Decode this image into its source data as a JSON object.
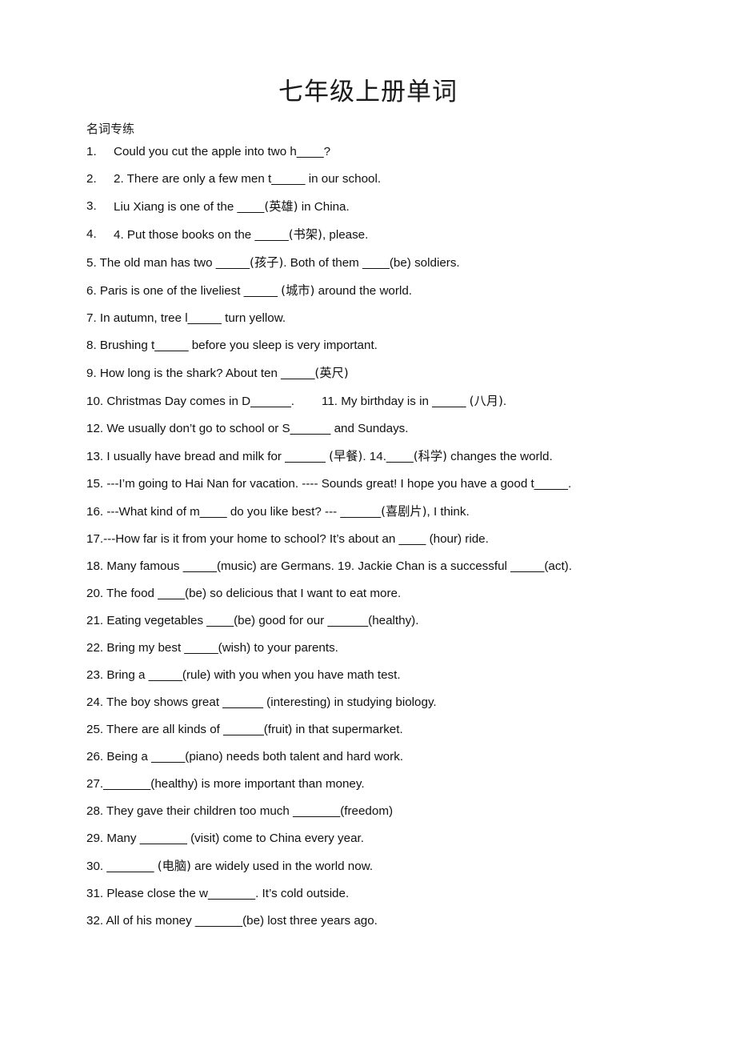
{
  "document": {
    "title": "七年级上册单词",
    "section_label": "名词专练",
    "questions": [
      {
        "n": "1.",
        "style": "numbered",
        "parts": [
          {
            "t": "text",
            "v": "Could you cut the apple into two h"
          },
          {
            "t": "blank",
            "v": "____"
          },
          {
            "t": "text",
            "v": "?"
          }
        ]
      },
      {
        "n": "2.",
        "style": "numbered",
        "parts": [
          {
            "t": "text",
            "v": "2. There are only a few men t"
          },
          {
            "t": "blank",
            "v": "_____"
          },
          {
            "t": "text",
            "v": " in our school."
          }
        ]
      },
      {
        "n": "3.",
        "style": "numbered",
        "parts": [
          {
            "t": "text",
            "v": "Liu Xiang is one of the "
          },
          {
            "t": "blank",
            "v": "____"
          },
          {
            "t": "zh",
            "v": "(英雄)"
          },
          {
            "t": "text",
            "v": " in China."
          }
        ]
      },
      {
        "n": "4.",
        "style": "numbered",
        "parts": [
          {
            "t": "text",
            "v": "4. Put those books on the "
          },
          {
            "t": "blank",
            "v": "_____"
          },
          {
            "t": "zh",
            "v": "(书架)"
          },
          {
            "t": "text",
            "v": ", please."
          }
        ]
      },
      {
        "n": "5.",
        "style": "inline",
        "parts": [
          {
            "t": "text",
            "v": "5. The old man has two "
          },
          {
            "t": "blank",
            "v": "_____"
          },
          {
            "t": "zh",
            "v": "(孩子)"
          },
          {
            "t": "text",
            "v": ". Both of them "
          },
          {
            "t": "blank",
            "v": "____"
          },
          {
            "t": "text",
            "v": "(be) soldiers."
          }
        ]
      },
      {
        "n": "6.",
        "style": "inline",
        "parts": [
          {
            "t": "text",
            "v": "6. Paris is one of the liveliest "
          },
          {
            "t": "blank",
            "v": "_____"
          },
          {
            "t": "text",
            "v": " "
          },
          {
            "t": "zh",
            "v": "(城市)"
          },
          {
            "t": "text",
            "v": " around the world."
          }
        ]
      },
      {
        "n": "7.",
        "style": "inline",
        "parts": [
          {
            "t": "text",
            "v": "7. In autumn, tree l"
          },
          {
            "t": "blank",
            "v": "_____"
          },
          {
            "t": "text",
            "v": " turn yellow."
          }
        ]
      },
      {
        "n": "8.",
        "style": "inline",
        "parts": [
          {
            "t": "text",
            "v": "8. Brushing t"
          },
          {
            "t": "blank",
            "v": "_____"
          },
          {
            "t": "text",
            "v": " before you sleep is very important."
          }
        ]
      },
      {
        "n": "9.",
        "style": "inline",
        "parts": [
          {
            "t": "text",
            "v": "9. How long is the shark? About ten "
          },
          {
            "t": "blank",
            "v": "_____"
          },
          {
            "t": "zh",
            "v": "(英尺)"
          }
        ]
      },
      {
        "n": "10.",
        "style": "inline",
        "parts": [
          {
            "t": "text",
            "v": "10. Christmas Day comes in D"
          },
          {
            "t": "blank",
            "v": "______"
          },
          {
            "t": "text",
            "v": "."
          },
          {
            "t": "gap",
            "v": ""
          },
          {
            "t": "text",
            "v": "11. My birthday is in "
          },
          {
            "t": "blank",
            "v": "_____"
          },
          {
            "t": "text",
            "v": " "
          },
          {
            "t": "zh",
            "v": "(八月)"
          },
          {
            "t": "text",
            "v": "."
          }
        ]
      },
      {
        "n": "12.",
        "style": "inline",
        "parts": [
          {
            "t": "text",
            "v": "12. We usually don’t go to school or S"
          },
          {
            "t": "blank",
            "v": "______"
          },
          {
            "t": "text",
            "v": " and Sundays."
          }
        ]
      },
      {
        "n": "13.",
        "style": "inline",
        "parts": [
          {
            "t": "text",
            "v": "13. I usually have bread and milk for "
          },
          {
            "t": "blank",
            "v": "______"
          },
          {
            "t": "text",
            "v": " "
          },
          {
            "t": "zh",
            "v": "(早餐)"
          },
          {
            "t": "text",
            "v": ".  14."
          },
          {
            "t": "blank",
            "v": "____"
          },
          {
            "t": "zh",
            "v": "(科学)"
          },
          {
            "t": "text",
            "v": " changes the world."
          }
        ]
      },
      {
        "n": "15.",
        "style": "inline",
        "parts": [
          {
            "t": "text",
            "v": "15. ---I’m going to Hai Nan for vacation. ---- Sounds great! I hope you have a good t"
          },
          {
            "t": "blank",
            "v": "_____"
          },
          {
            "t": "text",
            "v": "."
          }
        ]
      },
      {
        "n": "16.",
        "style": "inline",
        "parts": [
          {
            "t": "text",
            "v": "16. ---What kind of m"
          },
          {
            "t": "blank",
            "v": "____"
          },
          {
            "t": "text",
            "v": " do you like best? --- "
          },
          {
            "t": "blank",
            "v": "______"
          },
          {
            "t": "zh",
            "v": "(喜剧片)"
          },
          {
            "t": "text",
            "v": ", I think."
          }
        ]
      },
      {
        "n": "17.",
        "style": "inline",
        "parts": [
          {
            "t": "text",
            "v": "17.---How far is it from your home to school? It’s about an "
          },
          {
            "t": "blank",
            "v": "____"
          },
          {
            "t": "text",
            "v": " (hour) ride."
          }
        ]
      },
      {
        "n": "18.",
        "style": "inline",
        "parts": [
          {
            "t": "text",
            "v": "18. Many famous "
          },
          {
            "t": "blank",
            "v": "_____"
          },
          {
            "t": "text",
            "v": "(music) are Germans. 19. Jackie Chan is a successful "
          },
          {
            "t": "blank",
            "v": "_____"
          },
          {
            "t": "text",
            "v": "(act)."
          }
        ]
      },
      {
        "n": "20.",
        "style": "inline",
        "parts": [
          {
            "t": "text",
            "v": "20. The food "
          },
          {
            "t": "blank",
            "v": "____"
          },
          {
            "t": "text",
            "v": "(be) so delicious that I want to eat more."
          }
        ]
      },
      {
        "n": "21.",
        "style": "inline",
        "parts": [
          {
            "t": "text",
            "v": "21. Eating vegetables "
          },
          {
            "t": "blank",
            "v": "____"
          },
          {
            "t": "text",
            "v": "(be) good for our "
          },
          {
            "t": "blank",
            "v": "______"
          },
          {
            "t": "text",
            "v": "(healthy)."
          }
        ]
      },
      {
        "n": "22.",
        "style": "inline",
        "parts": [
          {
            "t": "text",
            "v": "22. Bring my best "
          },
          {
            "t": "blank",
            "v": "_____"
          },
          {
            "t": "text",
            "v": "(wish) to your parents."
          }
        ]
      },
      {
        "n": "23.",
        "style": "inline",
        "parts": [
          {
            "t": "text",
            "v": "23. Bring a "
          },
          {
            "t": "blank",
            "v": "_____"
          },
          {
            "t": "text",
            "v": "(rule) with you when you have math test."
          }
        ]
      },
      {
        "n": "24.",
        "style": "inline",
        "parts": [
          {
            "t": "text",
            "v": "24. The boy shows great "
          },
          {
            "t": "blank",
            "v": "______"
          },
          {
            "t": "text",
            "v": " (interesting) in studying biology."
          }
        ]
      },
      {
        "n": "25.",
        "style": "inline",
        "parts": [
          {
            "t": "text",
            "v": "25. There are all kinds of "
          },
          {
            "t": "blank",
            "v": "______"
          },
          {
            "t": "text",
            "v": "(fruit) in that supermarket."
          }
        ]
      },
      {
        "n": "26.",
        "style": "inline",
        "parts": [
          {
            "t": "text",
            "v": "26. Being a "
          },
          {
            "t": "blank",
            "v": "_____"
          },
          {
            "t": "text",
            "v": "(piano) needs both talent and hard work."
          }
        ]
      },
      {
        "n": "27.",
        "style": "inline",
        "parts": [
          {
            "t": "text",
            "v": "27."
          },
          {
            "t": "blank",
            "v": "_______"
          },
          {
            "t": "text",
            "v": "(healthy) is more important than money."
          }
        ]
      },
      {
        "n": "28.",
        "style": "inline",
        "parts": [
          {
            "t": "text",
            "v": "28. They gave their children too much "
          },
          {
            "t": "blank",
            "v": "_______"
          },
          {
            "t": "text",
            "v": "(freedom)"
          }
        ]
      },
      {
        "n": "29.",
        "style": "inline",
        "parts": [
          {
            "t": "text",
            "v": "29. Many "
          },
          {
            "t": "blank",
            "v": "_______"
          },
          {
            "t": "text",
            "v": " (visit) come to China every year."
          }
        ]
      },
      {
        "n": "30.",
        "style": "inline",
        "parts": [
          {
            "t": "text",
            "v": "30. "
          },
          {
            "t": "blank",
            "v": "_______"
          },
          {
            "t": "text",
            "v": " "
          },
          {
            "t": "zh",
            "v": "(电脑)"
          },
          {
            "t": "text",
            "v": " are widely used in the world now."
          }
        ]
      },
      {
        "n": "31.",
        "style": "inline",
        "parts": [
          {
            "t": "text",
            "v": "31. Please close the w"
          },
          {
            "t": "blank",
            "v": "_______"
          },
          {
            "t": "text",
            "v": ". It’s cold outside."
          }
        ]
      },
      {
        "n": "32.",
        "style": "inline",
        "parts": [
          {
            "t": "text",
            "v": "32. All of his money "
          },
          {
            "t": "blank",
            "v": "_______"
          },
          {
            "t": "text",
            "v": "(be) lost three years ago."
          }
        ]
      }
    ]
  }
}
